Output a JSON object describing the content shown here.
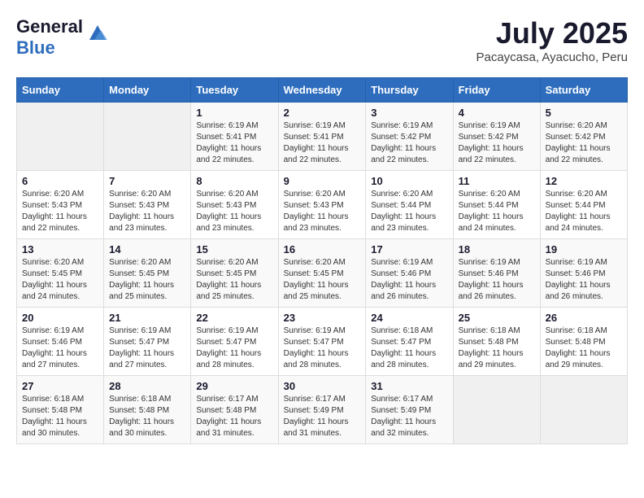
{
  "header": {
    "logo_line1": "General",
    "logo_line2": "Blue",
    "month_title": "July 2025",
    "subtitle": "Pacaycasa, Ayacucho, Peru"
  },
  "days_of_week": [
    "Sunday",
    "Monday",
    "Tuesday",
    "Wednesday",
    "Thursday",
    "Friday",
    "Saturday"
  ],
  "weeks": [
    [
      {
        "day": "",
        "sunrise": "",
        "sunset": "",
        "daylight": ""
      },
      {
        "day": "",
        "sunrise": "",
        "sunset": "",
        "daylight": ""
      },
      {
        "day": "1",
        "sunrise": "Sunrise: 6:19 AM",
        "sunset": "Sunset: 5:41 PM",
        "daylight": "Daylight: 11 hours and 22 minutes."
      },
      {
        "day": "2",
        "sunrise": "Sunrise: 6:19 AM",
        "sunset": "Sunset: 5:41 PM",
        "daylight": "Daylight: 11 hours and 22 minutes."
      },
      {
        "day": "3",
        "sunrise": "Sunrise: 6:19 AM",
        "sunset": "Sunset: 5:42 PM",
        "daylight": "Daylight: 11 hours and 22 minutes."
      },
      {
        "day": "4",
        "sunrise": "Sunrise: 6:19 AM",
        "sunset": "Sunset: 5:42 PM",
        "daylight": "Daylight: 11 hours and 22 minutes."
      },
      {
        "day": "5",
        "sunrise": "Sunrise: 6:20 AM",
        "sunset": "Sunset: 5:42 PM",
        "daylight": "Daylight: 11 hours and 22 minutes."
      }
    ],
    [
      {
        "day": "6",
        "sunrise": "Sunrise: 6:20 AM",
        "sunset": "Sunset: 5:43 PM",
        "daylight": "Daylight: 11 hours and 22 minutes."
      },
      {
        "day": "7",
        "sunrise": "Sunrise: 6:20 AM",
        "sunset": "Sunset: 5:43 PM",
        "daylight": "Daylight: 11 hours and 23 minutes."
      },
      {
        "day": "8",
        "sunrise": "Sunrise: 6:20 AM",
        "sunset": "Sunset: 5:43 PM",
        "daylight": "Daylight: 11 hours and 23 minutes."
      },
      {
        "day": "9",
        "sunrise": "Sunrise: 6:20 AM",
        "sunset": "Sunset: 5:43 PM",
        "daylight": "Daylight: 11 hours and 23 minutes."
      },
      {
        "day": "10",
        "sunrise": "Sunrise: 6:20 AM",
        "sunset": "Sunset: 5:44 PM",
        "daylight": "Daylight: 11 hours and 23 minutes."
      },
      {
        "day": "11",
        "sunrise": "Sunrise: 6:20 AM",
        "sunset": "Sunset: 5:44 PM",
        "daylight": "Daylight: 11 hours and 24 minutes."
      },
      {
        "day": "12",
        "sunrise": "Sunrise: 6:20 AM",
        "sunset": "Sunset: 5:44 PM",
        "daylight": "Daylight: 11 hours and 24 minutes."
      }
    ],
    [
      {
        "day": "13",
        "sunrise": "Sunrise: 6:20 AM",
        "sunset": "Sunset: 5:45 PM",
        "daylight": "Daylight: 11 hours and 24 minutes."
      },
      {
        "day": "14",
        "sunrise": "Sunrise: 6:20 AM",
        "sunset": "Sunset: 5:45 PM",
        "daylight": "Daylight: 11 hours and 25 minutes."
      },
      {
        "day": "15",
        "sunrise": "Sunrise: 6:20 AM",
        "sunset": "Sunset: 5:45 PM",
        "daylight": "Daylight: 11 hours and 25 minutes."
      },
      {
        "day": "16",
        "sunrise": "Sunrise: 6:20 AM",
        "sunset": "Sunset: 5:45 PM",
        "daylight": "Daylight: 11 hours and 25 minutes."
      },
      {
        "day": "17",
        "sunrise": "Sunrise: 6:19 AM",
        "sunset": "Sunset: 5:46 PM",
        "daylight": "Daylight: 11 hours and 26 minutes."
      },
      {
        "day": "18",
        "sunrise": "Sunrise: 6:19 AM",
        "sunset": "Sunset: 5:46 PM",
        "daylight": "Daylight: 11 hours and 26 minutes."
      },
      {
        "day": "19",
        "sunrise": "Sunrise: 6:19 AM",
        "sunset": "Sunset: 5:46 PM",
        "daylight": "Daylight: 11 hours and 26 minutes."
      }
    ],
    [
      {
        "day": "20",
        "sunrise": "Sunrise: 6:19 AM",
        "sunset": "Sunset: 5:46 PM",
        "daylight": "Daylight: 11 hours and 27 minutes."
      },
      {
        "day": "21",
        "sunrise": "Sunrise: 6:19 AM",
        "sunset": "Sunset: 5:47 PM",
        "daylight": "Daylight: 11 hours and 27 minutes."
      },
      {
        "day": "22",
        "sunrise": "Sunrise: 6:19 AM",
        "sunset": "Sunset: 5:47 PM",
        "daylight": "Daylight: 11 hours and 28 minutes."
      },
      {
        "day": "23",
        "sunrise": "Sunrise: 6:19 AM",
        "sunset": "Sunset: 5:47 PM",
        "daylight": "Daylight: 11 hours and 28 minutes."
      },
      {
        "day": "24",
        "sunrise": "Sunrise: 6:18 AM",
        "sunset": "Sunset: 5:47 PM",
        "daylight": "Daylight: 11 hours and 28 minutes."
      },
      {
        "day": "25",
        "sunrise": "Sunrise: 6:18 AM",
        "sunset": "Sunset: 5:48 PM",
        "daylight": "Daylight: 11 hours and 29 minutes."
      },
      {
        "day": "26",
        "sunrise": "Sunrise: 6:18 AM",
        "sunset": "Sunset: 5:48 PM",
        "daylight": "Daylight: 11 hours and 29 minutes."
      }
    ],
    [
      {
        "day": "27",
        "sunrise": "Sunrise: 6:18 AM",
        "sunset": "Sunset: 5:48 PM",
        "daylight": "Daylight: 11 hours and 30 minutes."
      },
      {
        "day": "28",
        "sunrise": "Sunrise: 6:18 AM",
        "sunset": "Sunset: 5:48 PM",
        "daylight": "Daylight: 11 hours and 30 minutes."
      },
      {
        "day": "29",
        "sunrise": "Sunrise: 6:17 AM",
        "sunset": "Sunset: 5:48 PM",
        "daylight": "Daylight: 11 hours and 31 minutes."
      },
      {
        "day": "30",
        "sunrise": "Sunrise: 6:17 AM",
        "sunset": "Sunset: 5:49 PM",
        "daylight": "Daylight: 11 hours and 31 minutes."
      },
      {
        "day": "31",
        "sunrise": "Sunrise: 6:17 AM",
        "sunset": "Sunset: 5:49 PM",
        "daylight": "Daylight: 11 hours and 32 minutes."
      },
      {
        "day": "",
        "sunrise": "",
        "sunset": "",
        "daylight": ""
      },
      {
        "day": "",
        "sunrise": "",
        "sunset": "",
        "daylight": ""
      }
    ]
  ]
}
